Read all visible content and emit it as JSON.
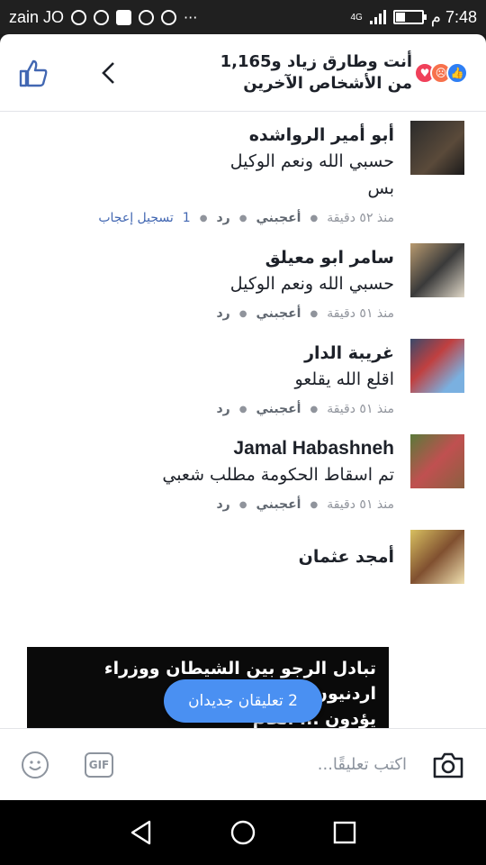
{
  "status_bar": {
    "carrier": "zain JO",
    "network": "4G",
    "time": "7:48 م"
  },
  "header": {
    "title": "أنت وطارق زياد و1,165 من الأشخاص الآخرين",
    "reaction_icons": [
      "love-reaction-icon",
      "angry-reaction-icon",
      "like-reaction-icon"
    ],
    "accent_color": "#4267b2"
  },
  "comments": [
    {
      "name": "أبو أمير الرواشده",
      "lines": [
        "حسبي الله ونعم الوكيل",
        "بس"
      ],
      "time": "منذ ٥٢ دقيقة",
      "like_label": "أعجبني",
      "reply_label": "رد",
      "likes_count": "1",
      "likes_label": "تسجيل إعجاب"
    },
    {
      "name": "سامر ابو معيلق",
      "lines": [
        "حسبي الله ونعم الوكيل"
      ],
      "time": "منذ ٥١ دقيقة",
      "like_label": "أعجبني",
      "reply_label": "رد"
    },
    {
      "name": "غريبة الدار",
      "lines": [
        "اقلع الله يقلعو"
      ],
      "time": "منذ ٥١ دقيقة",
      "like_label": "أعجبني",
      "reply_label": "رد"
    },
    {
      "name": "Jamal Habashneh",
      "lines": [
        "تم اسقاط الحكومة مطلب شعبي"
      ],
      "time": "منذ ٥١ دقيقة",
      "like_label": "أعجبني",
      "reply_label": "رد"
    },
    {
      "name": "أمجد عثمان",
      "lines": [],
      "image_text": [
        "تبادل الرجو بين الشيطان ووزراء اردنيون",
        "يؤدون ... العام"
      ]
    }
  ],
  "new_comments_pill": "2 تعليقان جديدان",
  "composer": {
    "placeholder": "اكتب تعليقًا...",
    "gif_label": "GIF"
  }
}
